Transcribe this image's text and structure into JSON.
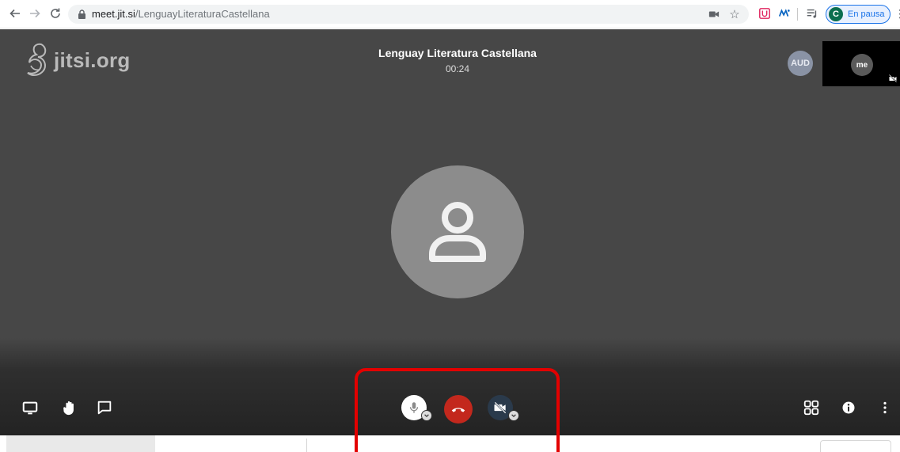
{
  "browser": {
    "url_domain": "meet.jit.si",
    "url_path": "/LenguayLiteraturaCastellana",
    "profile_initial": "C",
    "profile_status": "En pausa"
  },
  "meeting": {
    "logo_text": "jitsi.org",
    "subject": "Lenguay Literatura Castellana",
    "timer": "00:24",
    "remote_badge": "AUD",
    "local_label": "me"
  },
  "colors": {
    "stage_bg": "#474747",
    "hangup": "#c3281d",
    "highlight": "#e30000",
    "profile_accent": "#1a73e8"
  },
  "icons": {
    "left_toolbar": [
      "screen-share-icon",
      "raise-hand-icon",
      "chat-icon"
    ],
    "center_toolbar": [
      "microphone-icon",
      "hangup-icon",
      "camera-off-icon"
    ],
    "right_toolbar": [
      "tile-view-icon",
      "info-icon",
      "more-vertical-icon"
    ]
  }
}
